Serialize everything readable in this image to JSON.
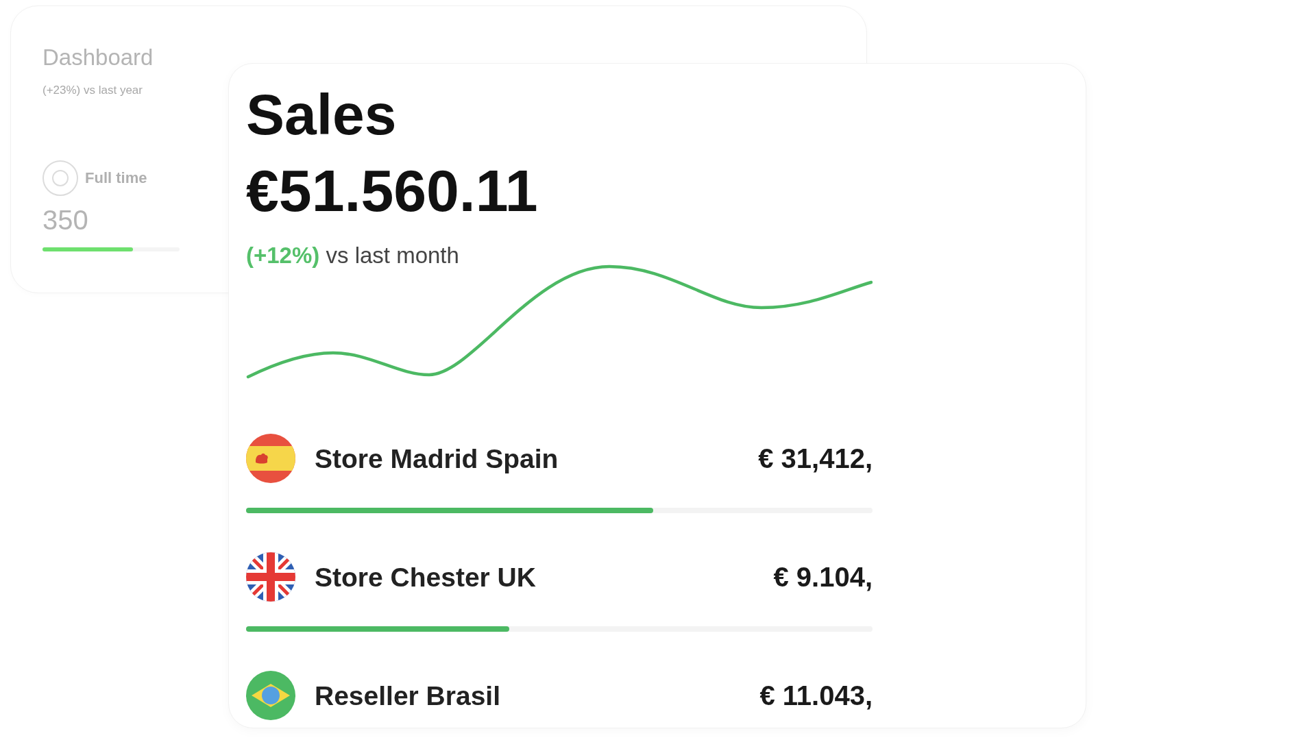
{
  "background_card": {
    "title": "Dashboard",
    "subtitle": "(+23%) vs last year",
    "stat_label": "Full time",
    "stat_value": "350",
    "level": 0.66
  },
  "sales_card": {
    "title": "Sales",
    "total": "€51.560.11",
    "change": "(+12%)",
    "comparison": "vs last month",
    "stores": [
      {
        "name": "Store Madrid Spain",
        "amount": "€ 31,412,",
        "level": 0.65
      },
      {
        "name": "Store Chester UK",
        "amount": "€ 9.104,",
        "level": 0.42
      },
      {
        "name": "Reseller Brasil",
        "amount": "€ 11.043,"
      }
    ]
  }
}
